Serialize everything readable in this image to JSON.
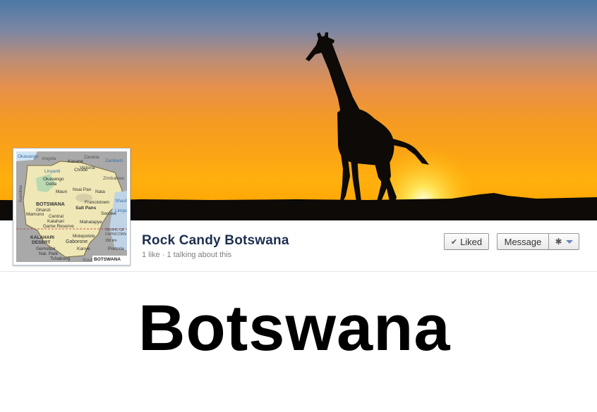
{
  "page": {
    "name": "Rock Candy Botswana",
    "stats": "1 like · 1 talking about this"
  },
  "buttons": {
    "liked_label": "Liked",
    "message_label": "Message"
  },
  "icons": {
    "liked": "check-icon",
    "settings": "gear-icon",
    "dropdown": "caret-down-icon"
  },
  "profile_map": {
    "country": "BOTSWANA",
    "labels": [
      "Okavango River",
      "Angola",
      "Zambia",
      "Zambezi River",
      "Kasane",
      "Victoria Falls",
      "Linyanti River",
      "Chobe Nat. Park",
      "Okavango Delta",
      "Maun",
      "Nxai Pan Nat. Park",
      "Nata",
      "Zimbabwe",
      "Namibia",
      "Ghanzi",
      "Francistown",
      "Salt Pans",
      "Shashe River",
      "Limpopo River",
      "Mamuno",
      "Central Kalahari Game Reserve",
      "Serowe",
      "Mahalapye",
      "KALAHARI DESERT",
      "Molepolole",
      "Gaborone",
      "TROPIC OF CAPRICORN",
      "Gemsbok Nat. Park",
      "Kanye",
      "Pretoria",
      "Tshabong",
      "South",
      "BOTSWANA",
      "150 km"
    ]
  },
  "main": {
    "title": "Botswana"
  },
  "colors": {
    "page_name": "#1d2f4f",
    "sunset_orange": "#f59a23",
    "silhouette": "#0d0a08"
  }
}
